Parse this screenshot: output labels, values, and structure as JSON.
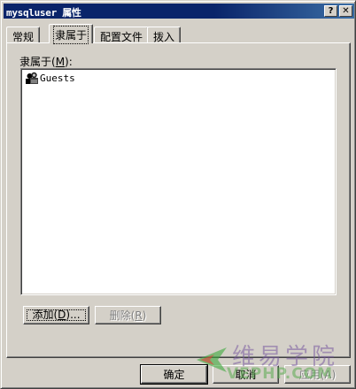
{
  "window": {
    "title": "mysqluser 属性",
    "help_glyph": "?",
    "close_glyph": "✕"
  },
  "tabs": [
    {
      "label": "常规",
      "active": false
    },
    {
      "label": "隶属于",
      "active": true
    },
    {
      "label": "配置文件",
      "active": false
    },
    {
      "label": "拨入",
      "active": false
    }
  ],
  "member_of": {
    "label_prefix": "隶属于(",
    "label_key": "M",
    "label_suffix": "):",
    "items": [
      {
        "name": "Guests",
        "icon": "user-group-icon"
      }
    ]
  },
  "buttons": {
    "add": {
      "prefix": "添加(",
      "key": "D",
      "suffix": ")..."
    },
    "remove": {
      "prefix": "删除(",
      "key": "R",
      "suffix": ")"
    },
    "ok": "确定",
    "cancel": "取消",
    "apply": "应用(A)"
  },
  "watermark": {
    "cn": "维易学院",
    "en": "VEPHP.COM"
  },
  "colors": {
    "face": "#d4d0c8",
    "titlebar": "#0a246a",
    "disabled_text": "#808080"
  }
}
